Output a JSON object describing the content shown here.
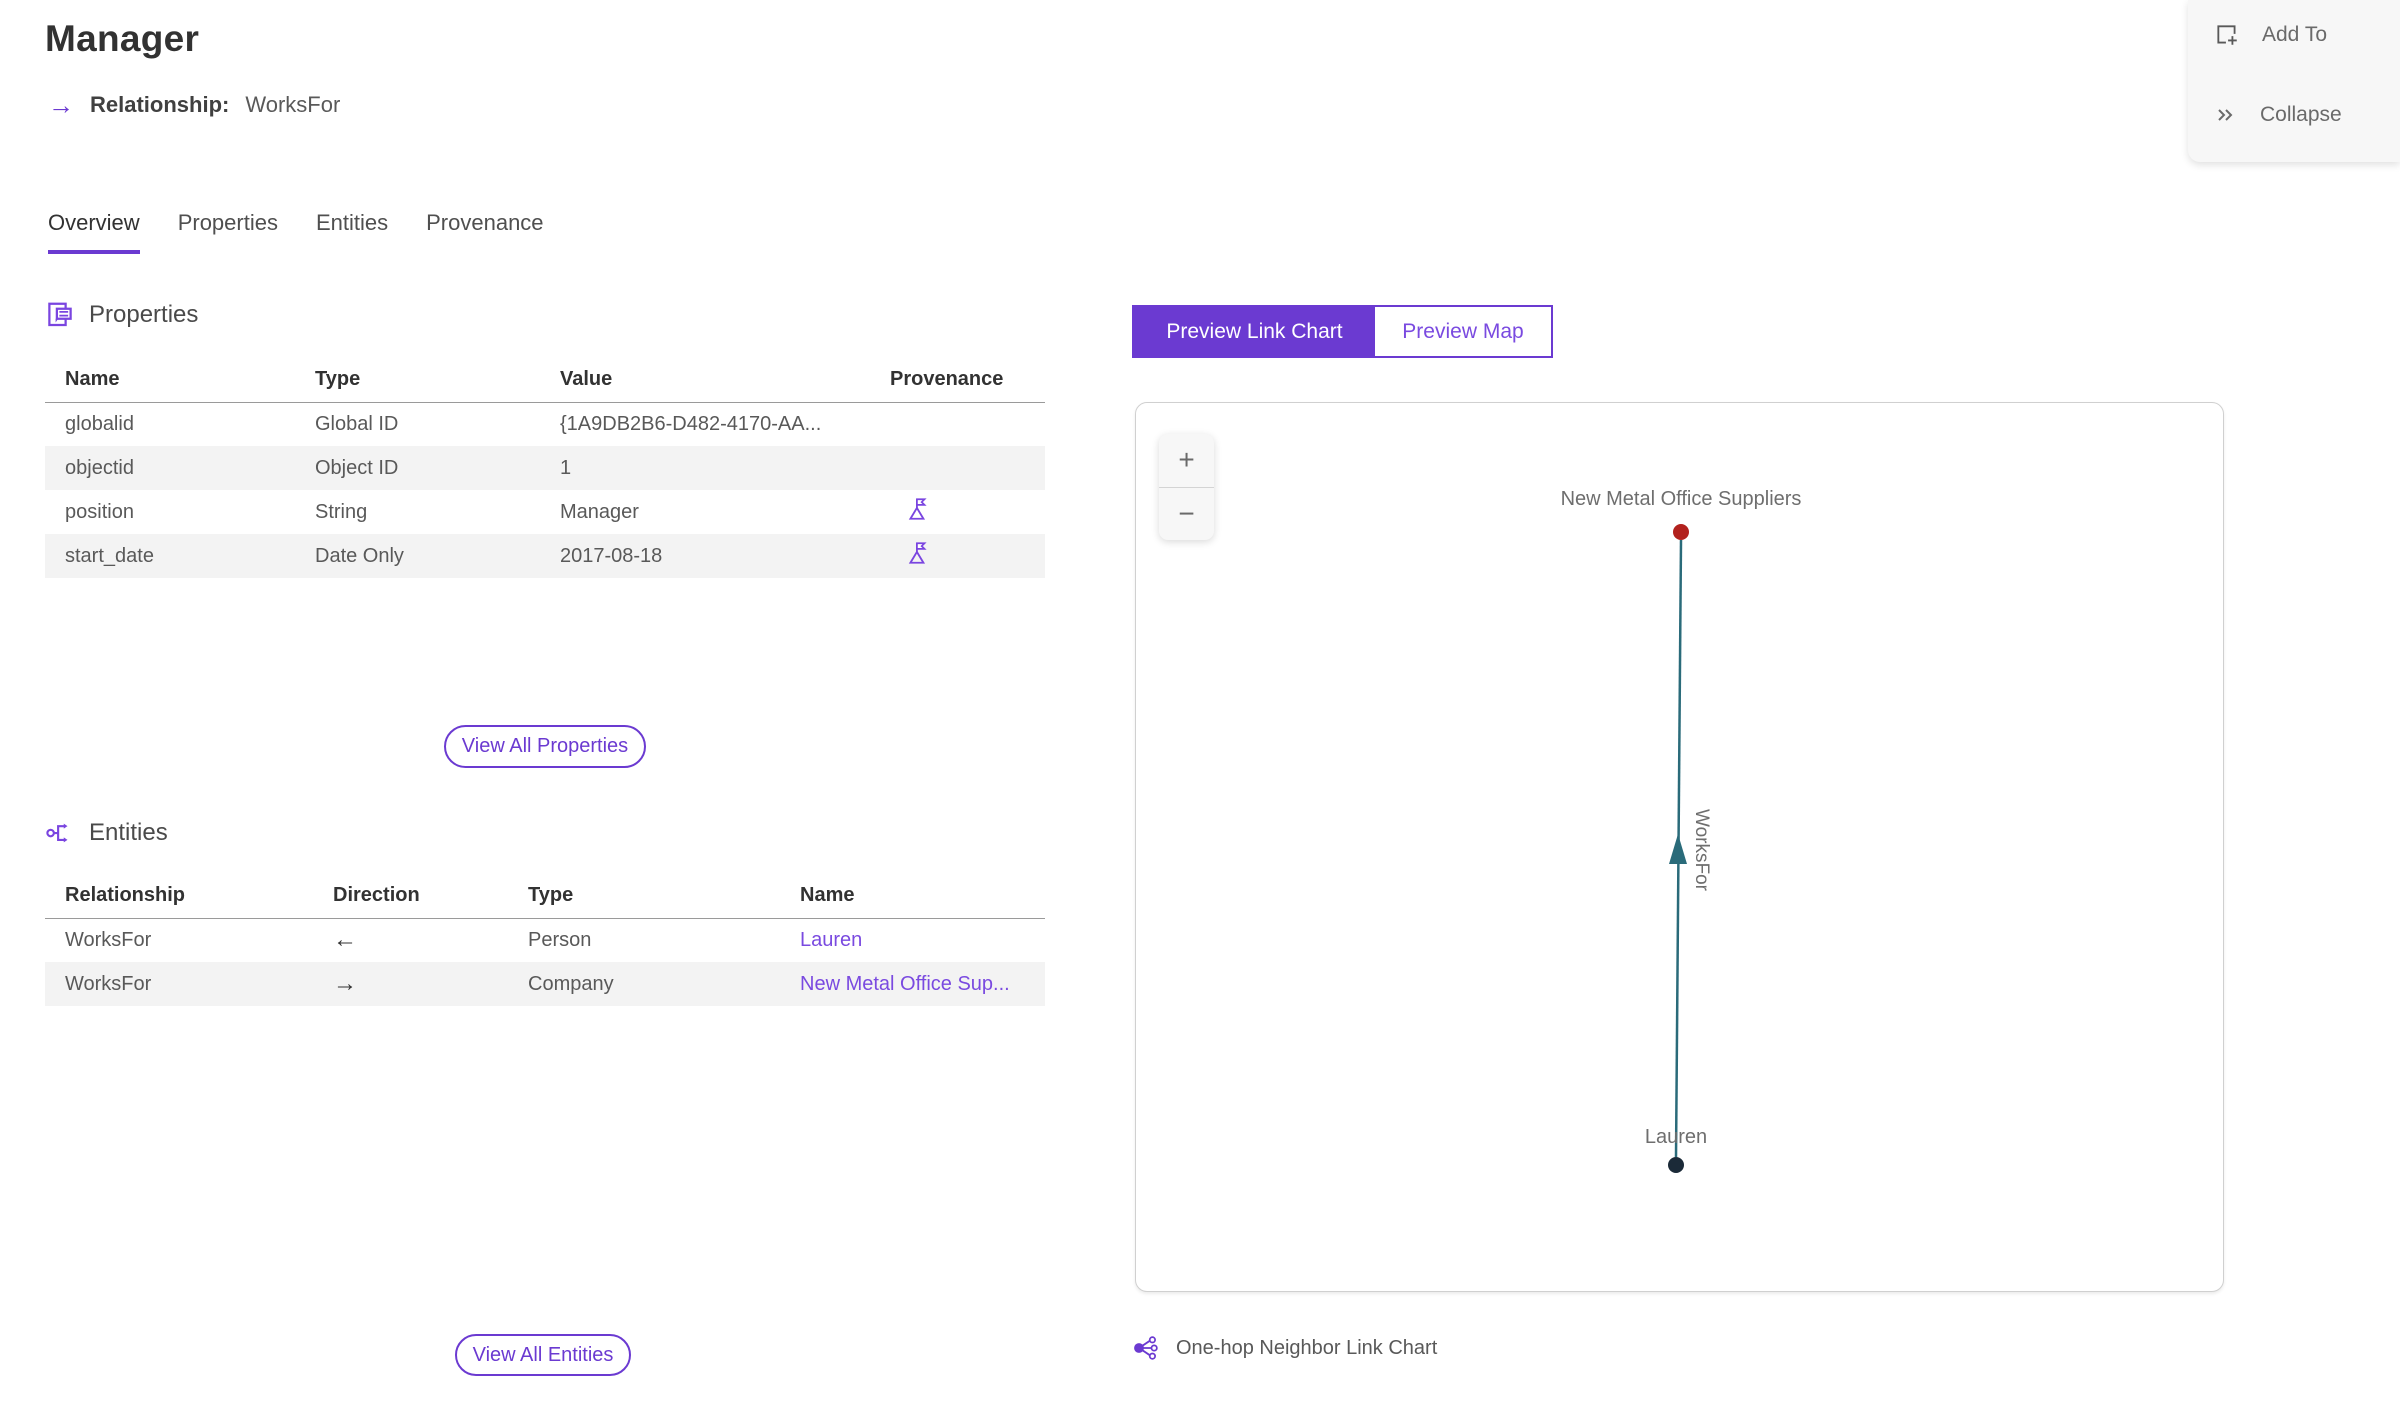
{
  "header": {
    "title": "Manager",
    "relationship_arrow": "→",
    "relationship_label": "Relationship:",
    "relationship_value": "WorksFor"
  },
  "actions": {
    "add_to": "Add To",
    "collapse": "Collapse"
  },
  "tabs": [
    {
      "label": "Overview",
      "active": true
    },
    {
      "label": "Properties",
      "active": false
    },
    {
      "label": "Entities",
      "active": false
    },
    {
      "label": "Provenance",
      "active": false
    }
  ],
  "properties_section": {
    "title": "Properties",
    "columns": [
      "Name",
      "Type",
      "Value",
      "Provenance"
    ],
    "rows": [
      {
        "name": "globalid",
        "type": "Global ID",
        "value": "{1A9DB2B6-D482-4170-AA...",
        "provenance": false
      },
      {
        "name": "objectid",
        "type": "Object ID",
        "value": "1",
        "provenance": false
      },
      {
        "name": "position",
        "type": "String",
        "value": "Manager",
        "provenance": true
      },
      {
        "name": "start_date",
        "type": "Date Only",
        "value": "2017-08-18",
        "provenance": true
      }
    ],
    "view_all_label": "View All Properties"
  },
  "entities_section": {
    "title": "Entities",
    "columns": [
      "Relationship",
      "Direction",
      "Type",
      "Name"
    ],
    "rows": [
      {
        "relationship": "WorksFor",
        "direction": "←",
        "type": "Person",
        "name": "Lauren"
      },
      {
        "relationship": "WorksFor",
        "direction": "→",
        "type": "Company",
        "name": "New Metal Office Sup..."
      }
    ],
    "view_all_label": "View All Entities"
  },
  "preview": {
    "toggle": [
      {
        "label": "Preview Link Chart",
        "active": true
      },
      {
        "label": "Preview Map",
        "active": false
      }
    ],
    "zoom_in": "+",
    "zoom_out": "−",
    "caption": "One-hop Neighbor Link Chart",
    "graph": {
      "nodes": [
        {
          "label": "New Metal Office Suppliers",
          "color": "#b2211d"
        },
        {
          "label": "Lauren",
          "color": "#1b2a38"
        }
      ],
      "edges": [
        {
          "label": "WorksFor",
          "from": "Lauren",
          "to": "New Metal Office Suppliers",
          "color": "#2a6b7a"
        }
      ]
    }
  },
  "colors": {
    "accent_purple": "#6b3ad1",
    "link_purple": "#7a4ae0",
    "node_red": "#b2211d",
    "node_navy": "#1b2a38",
    "edge_teal": "#2a6b7a"
  }
}
